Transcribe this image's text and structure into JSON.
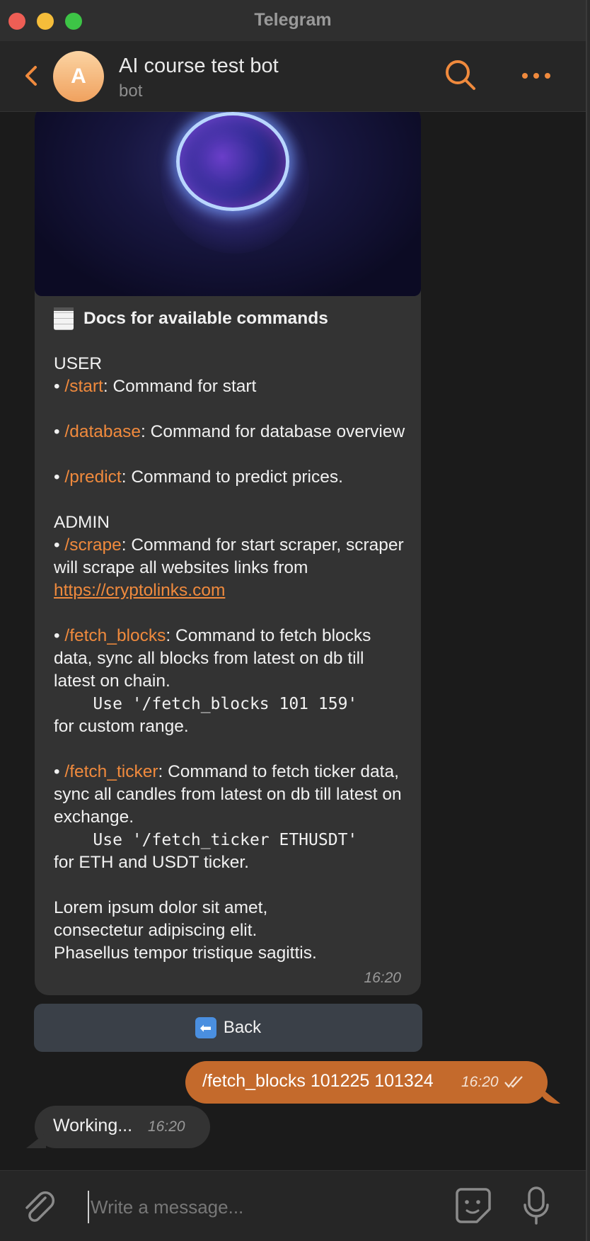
{
  "window": {
    "title": "Telegram"
  },
  "header": {
    "avatar_letter": "A",
    "name": "AI course test bot",
    "subtitle": "bot"
  },
  "messages": {
    "doc": {
      "title": "Docs for available commands",
      "section_user": "USER",
      "start_cmd": "/start",
      "start_desc": ": Command for start",
      "database_cmd": "/database",
      "database_desc": ": Command for database overview",
      "predict_cmd": "/predict",
      "predict_desc": ": Command to predict prices.",
      "section_admin": "ADMIN",
      "scrape_cmd": "/scrape",
      "scrape_desc": ": Command for start scraper, scraper will scrape all websites links from ",
      "scrape_link": "https://cryptolinks.com",
      "fetch_blocks_cmd": "/fetch_blocks",
      "fetch_blocks_desc": ": Command to fetch blocks data, sync all blocks from latest on db till latest on chain.",
      "fetch_blocks_use": "    Use '/fetch_blocks 101 159'",
      "fetch_blocks_use_tail": "for custom range.",
      "fetch_ticker_cmd": "/fetch_ticker",
      "fetch_ticker_desc": ": Command to fetch ticker data, sync all candles from latest on db till latest on exchange.",
      "fetch_ticker_use": "    Use '/fetch_ticker ETHUSDT'",
      "fetch_ticker_use_tail": "for ETH and USDT ticker.",
      "lorem": "Lorem ipsum dolor sit amet, consectetur adipiscing elit. Phasellus tempor tristique sagittis.",
      "time": "16:20"
    },
    "back_button_label": "Back",
    "outgoing": {
      "text": "/fetch_blocks 101225 101324",
      "time": "16:20"
    },
    "working": {
      "text": "Working...",
      "time": "16:20"
    }
  },
  "composer": {
    "placeholder": "Write a message..."
  },
  "colors": {
    "accent": "#f08a3d",
    "outgoing_bubble": "#c46a2c",
    "incoming_bubble": "#333333"
  }
}
